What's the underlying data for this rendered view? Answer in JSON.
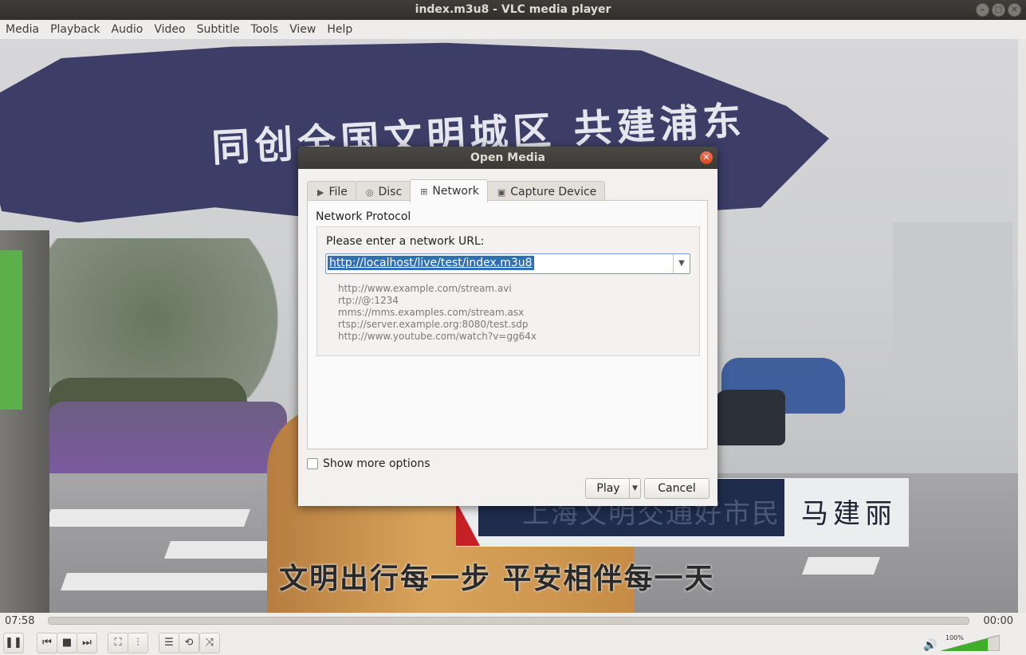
{
  "window": {
    "title": "index.m3u8 - VLC media player"
  },
  "menubar": {
    "items": [
      "Media",
      "Playback",
      "Audio",
      "Video",
      "Subtitle",
      "Tools",
      "View",
      "Help"
    ]
  },
  "video": {
    "umbrella_text": "同创全国文明城区 共建浦东",
    "banner_left": "上海文明交通好市民",
    "banner_name": "马建丽",
    "subtitle": "文明出行每一步 平安相伴每一天"
  },
  "dialog": {
    "title": "Open Media",
    "tabs": [
      {
        "label": "File",
        "icon": "file-icon"
      },
      {
        "label": "Disc",
        "icon": "disc-icon"
      },
      {
        "label": "Network",
        "icon": "network-icon",
        "active": true
      },
      {
        "label": "Capture Device",
        "icon": "capture-device-icon"
      }
    ],
    "network_protocol_label": "Network Protocol",
    "url_prompt": "Please enter a network URL:",
    "url_value": "http://localhost/live/test/index.m3u8",
    "examples": [
      "http://www.example.com/stream.avi",
      "rtp://@:1234",
      "mms://mms.examples.com/stream.asx",
      "rtsp://server.example.org:8080/test.sdp",
      "http://www.youtube.com/watch?v=gg64x"
    ],
    "show_more_options": "Show more options",
    "show_more_checked": false,
    "play_label": "Play",
    "cancel_label": "Cancel"
  },
  "playback": {
    "elapsed": "07:58",
    "remaining": "00:00",
    "volume_label": "100%",
    "volume_level": 1.0
  },
  "colors": {
    "dialog_bg": "#f2f1f0",
    "selection": "#2f6fb7",
    "close_button": "#e05a3a",
    "volume_fill": "#3fae2a"
  }
}
